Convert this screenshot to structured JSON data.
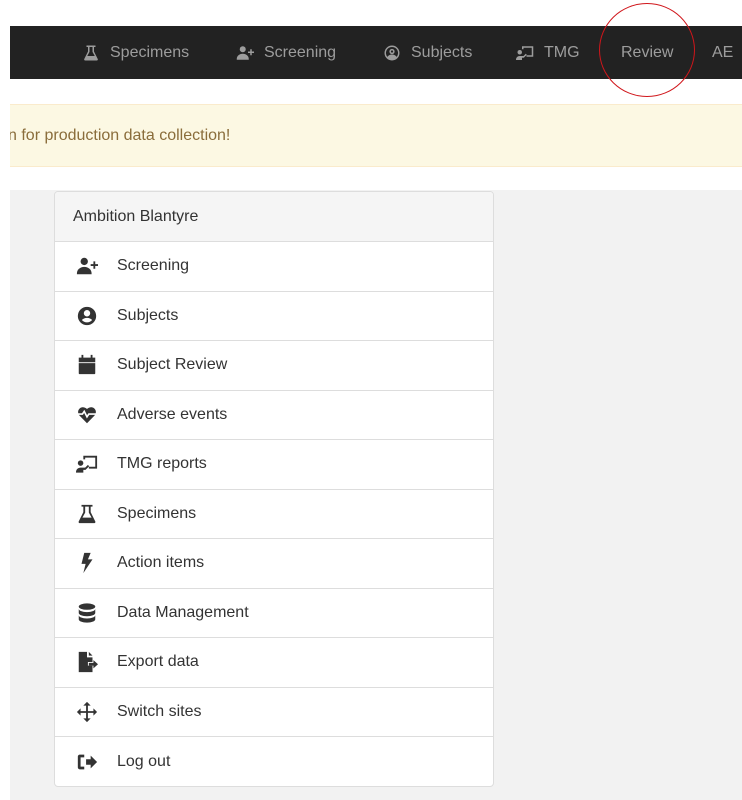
{
  "navbar": {
    "items": [
      {
        "label": "Specimens",
        "icon": "flask-icon"
      },
      {
        "label": "Screening",
        "icon": "user-plus-icon"
      },
      {
        "label": "Subjects",
        "icon": "user-circle-icon"
      },
      {
        "label": "TMG",
        "icon": "chalkboard-teacher-icon"
      },
      {
        "label": "Review",
        "icon": ""
      },
      {
        "label": "AE",
        "icon": ""
      }
    ],
    "highlight_color": "#d0161b"
  },
  "alert": {
    "text": "n for production data collection!"
  },
  "panel": {
    "title": "Ambition Blantyre",
    "items": [
      {
        "label": "Screening",
        "icon": "user-plus-icon"
      },
      {
        "label": "Subjects",
        "icon": "user-circle-icon"
      },
      {
        "label": "Subject Review",
        "icon": "calendar-icon"
      },
      {
        "label": "Adverse events",
        "icon": "heartbeat-icon"
      },
      {
        "label": "TMG reports",
        "icon": "chalkboard-teacher-icon"
      },
      {
        "label": "Specimens",
        "icon": "flask-icon"
      },
      {
        "label": "Action items",
        "icon": "bolt-icon"
      },
      {
        "label": "Data Management",
        "icon": "database-icon"
      },
      {
        "label": "Export data",
        "icon": "file-export-icon"
      },
      {
        "label": "Switch sites",
        "icon": "arrows-icon"
      },
      {
        "label": "Log out",
        "icon": "sign-out-icon"
      }
    ]
  },
  "colors": {
    "navbar_bg": "#222222",
    "nav_text": "#9d9d9d",
    "alert_bg": "#fcf8e3",
    "alert_text": "#8a6d3b",
    "panel_border": "#dddddd"
  }
}
